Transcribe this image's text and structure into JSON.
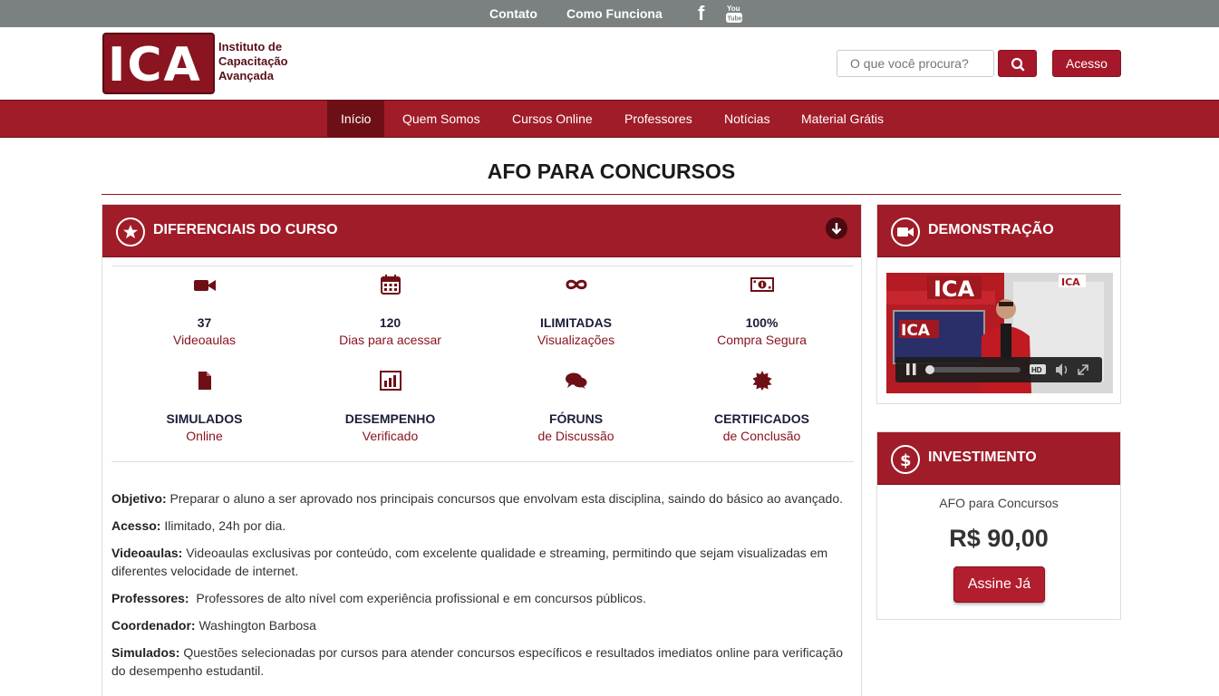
{
  "topbar": {
    "contato": "Contato",
    "como_funciona": "Como Funciona",
    "facebook_icon": "facebook-icon",
    "youtube_icon": "youtube-icon",
    "fb_glyph": "f"
  },
  "header": {
    "logo_letters": "ICA",
    "logo_line1": "Instituto de",
    "logo_line2": "Capacitação",
    "logo_line3": "Avançada",
    "search_placeholder": "O que você procura?",
    "acesso_label": "Acesso"
  },
  "nav": {
    "items": [
      {
        "label": "Início",
        "active": true
      },
      {
        "label": "Quem Somos",
        "active": false
      },
      {
        "label": "Cursos Online",
        "active": false
      },
      {
        "label": "Professores",
        "active": false
      },
      {
        "label": "Notícias",
        "active": false
      },
      {
        "label": "Material Grátis",
        "active": false
      }
    ]
  },
  "page": {
    "title": "AFO PARA CONCURSOS"
  },
  "differentials": {
    "title": "DIFERENCIAIS DO CURSO",
    "features": [
      {
        "icon": "video-camera-icon",
        "title": "37",
        "subtitle": "Videoaulas"
      },
      {
        "icon": "calendar-icon",
        "title": "120",
        "subtitle": "Dias para acessar"
      },
      {
        "icon": "infinity-icon",
        "title": "ILIMITADAS",
        "subtitle": "Visualizações"
      },
      {
        "icon": "money-icon",
        "title": "100%",
        "subtitle": "Compra Segura"
      },
      {
        "icon": "file-icon",
        "title": "SIMULADOS",
        "subtitle": "Online"
      },
      {
        "icon": "bar-chart-icon",
        "title": "DESEMPENHO",
        "subtitle": "Verificado"
      },
      {
        "icon": "comments-icon",
        "title": "FÓRUNS",
        "subtitle": "de Discussão"
      },
      {
        "icon": "certificate-icon",
        "title": "CERTIFICADOS",
        "subtitle": "de Conclusão"
      }
    ],
    "description": [
      {
        "label": "Objetivo:",
        "text": " Preparar o aluno a ser aprovado nos principais concursos que envolvam esta disciplina, saindo do básico ao avançado."
      },
      {
        "label": "Acesso:",
        "text": " Ilimitado, 24h por dia."
      },
      {
        "label": "Videoaulas:",
        "text": " Videoaulas exclusivas por conteúdo, com excelente qualidade e streaming, permitindo que sejam visualizadas em diferentes velocidade de internet."
      },
      {
        "label": "Professores:",
        "text": "  Professores de alto nível com experiência profissional e em concursos públicos."
      },
      {
        "label": "Coordenador:",
        "text": " Washington Barbosa"
      },
      {
        "label": "Simulados:",
        "text": " Questões selecionadas por cursos para atender concursos específicos e resultados imediatos online para verificação do desempenho estudantil."
      }
    ]
  },
  "demo": {
    "title": "DEMONSTRAÇÃO",
    "video_logo": "ICA",
    "hd_label": "HD"
  },
  "investment": {
    "title": "INVESTIMENTO",
    "course_name": "AFO para Concursos",
    "price": "R$ 90,00",
    "button_label": "Assine Já"
  },
  "colors": {
    "brand": "#a01c28",
    "brand_dark": "#6e0f16",
    "topbar": "#7b8180"
  }
}
